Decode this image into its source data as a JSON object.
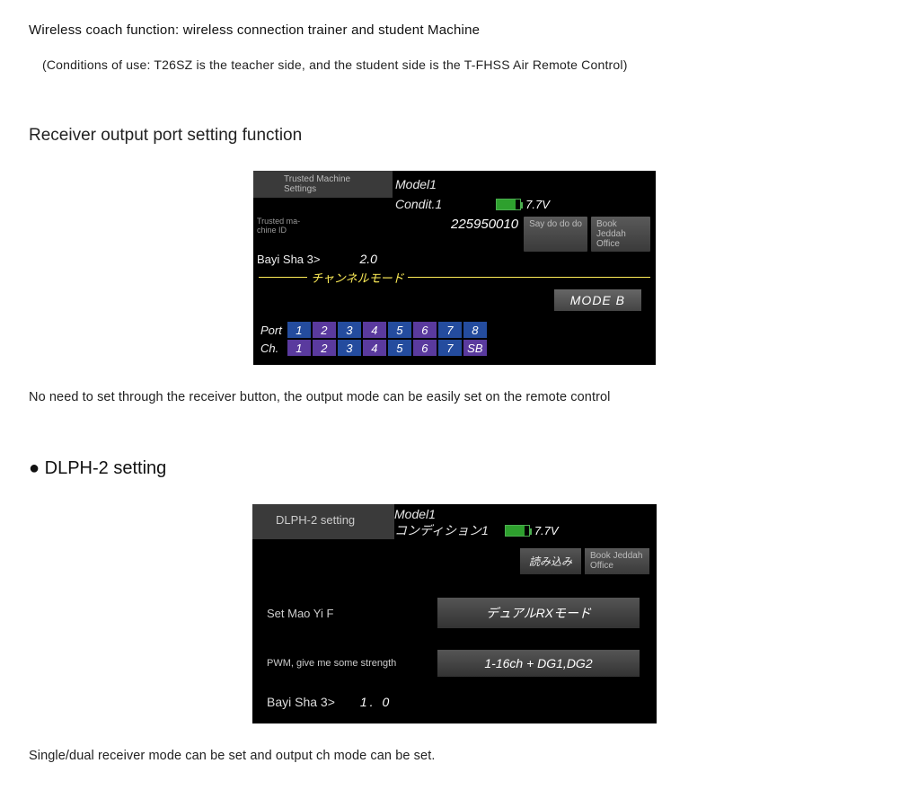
{
  "intro": {
    "line1": "Wireless coach function: wireless connection trainer and student Machine",
    "line2": "(Conditions of use: T26SZ is the teacher side, and the student side is the T-FHSS Air Remote Control)"
  },
  "section1": {
    "heading": "Receiver output port setting function",
    "caption": "No need to set through the receiver button, the output mode can be easily set on the remote control"
  },
  "screen1": {
    "title_tab": "Trusted Machine Settings",
    "model": "Model1",
    "condit": "Condit.1",
    "voltage": "7.7V",
    "id_label": "Trusted ma-\nchine ID",
    "id_value": "225950010",
    "btn_read": "Say do do do",
    "btn_book": "Book Jeddah Office",
    "bayi": "Bayi Sha 3>",
    "version": "2.0",
    "channel_mode": "チャンネルモード",
    "mode_btn": "MODE B",
    "row_port_label": "Port",
    "row_ch_label": "Ch.",
    "ports": [
      "1",
      "2",
      "3",
      "4",
      "5",
      "6",
      "7",
      "8"
    ],
    "chs": [
      "1",
      "2",
      "3",
      "4",
      "5",
      "6",
      "7",
      "SB"
    ]
  },
  "section2": {
    "heading": "● DLPH-2 setting",
    "caption": "Single/dual receiver mode can be set and output ch mode can be set."
  },
  "screen2": {
    "title_tab": "DLPH-2 setting",
    "model": "Model1",
    "condit": "コンディション1",
    "voltage": "7.7V",
    "read_btn": "読み込み",
    "book_btn": "Book Jeddah Office",
    "row1_label": "Set Mao Yi F",
    "row1_value": "デュアルRXモード",
    "row2_label": "PWM, give me some strength",
    "row2_value": "1-16ch + DG1,DG2",
    "bayi": "Bayi Sha 3>",
    "bayi_val": "1. 0"
  }
}
